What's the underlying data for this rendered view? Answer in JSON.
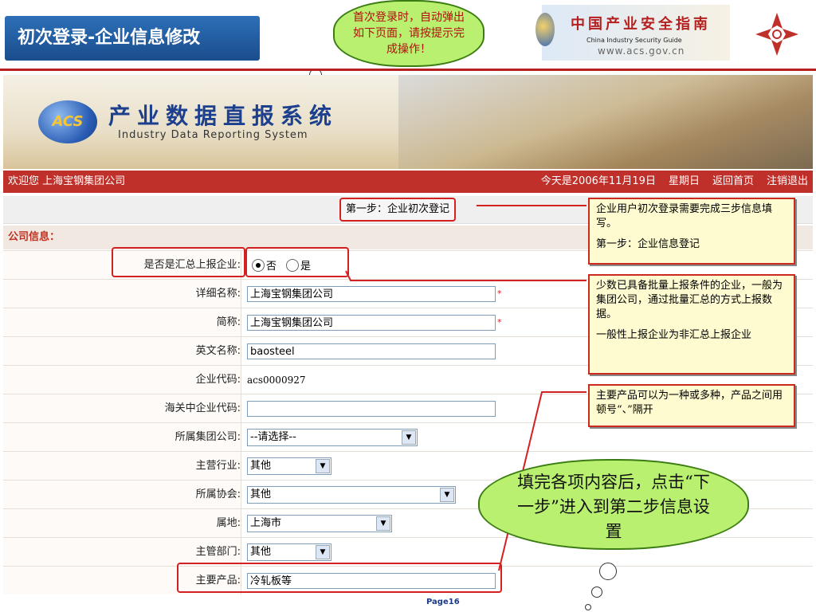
{
  "slide_title": "初次登录-企业信息修改",
  "callout_top": "首次登录时，自动弹出如下页面，请按提示完成操作！",
  "logo": {
    "cn": "中国产业安全指南",
    "en": "China   Industry   Security   Guide",
    "url": "www.acs.gov.cn"
  },
  "header": {
    "badge": "ACS",
    "system_cn": "产业数据直报系统",
    "system_en": "Industry  Data  Reporting  System"
  },
  "welcome": {
    "greeting": "欢迎您  上海宝钢集团公司",
    "date": "今天是2006年11月19日",
    "weekday": "星期日",
    "home_link": "返回首页",
    "logout_link": "注销退出"
  },
  "step_label": "第一步：企业初次登记",
  "section_head": "公司信息：",
  "form": {
    "summary_label": "是否是汇总上报企业:",
    "radio_no": "否",
    "radio_yes": "是",
    "full_name_label": "详细名称:",
    "full_name_value": "上海宝钢集团公司",
    "short_name_label": "简称:",
    "short_name_value": "上海宝钢集团公司",
    "english_name_label": "英文名称:",
    "english_name_value": "baosteel",
    "code_label": "企业代码:",
    "code_value": "acs0000927",
    "customs_label": "海关中企业代码:",
    "customs_value": "",
    "group_label": "所属集团公司:",
    "group_value": "--请选择--",
    "industry_label": "主营行业:",
    "industry_value": "其他",
    "association_label": "所属协会:",
    "association_value": "其他",
    "location_label": "属地:",
    "location_value": "上海市",
    "department_label": "主管部门:",
    "department_value": "其他",
    "products_label": "主要产品:",
    "products_value": "冷轧板等",
    "required_mark": "*"
  },
  "notes": {
    "note1_p1": "企业用户初次登录需要完成三步信息填写。",
    "note1_p2": "第一步：企业信息登记",
    "note2_p1": "少数已具备批量上报条件的企业，一般为集团公司，通过批量汇总的方式上报数据。",
    "note2_p2": "一般性上报企业为非汇总上报企业",
    "note3": "主要产品可以为一种或多种，产品之间用顿号“、”隔开"
  },
  "cloud_bottom": "填完各项内容后，点击“下一步”进入到第二步信息设置",
  "page_number": "Page16",
  "colors": {
    "accent_red": "#c0302a",
    "title_blue": "#2d6fb8",
    "cloud_green": "#b9f070"
  }
}
